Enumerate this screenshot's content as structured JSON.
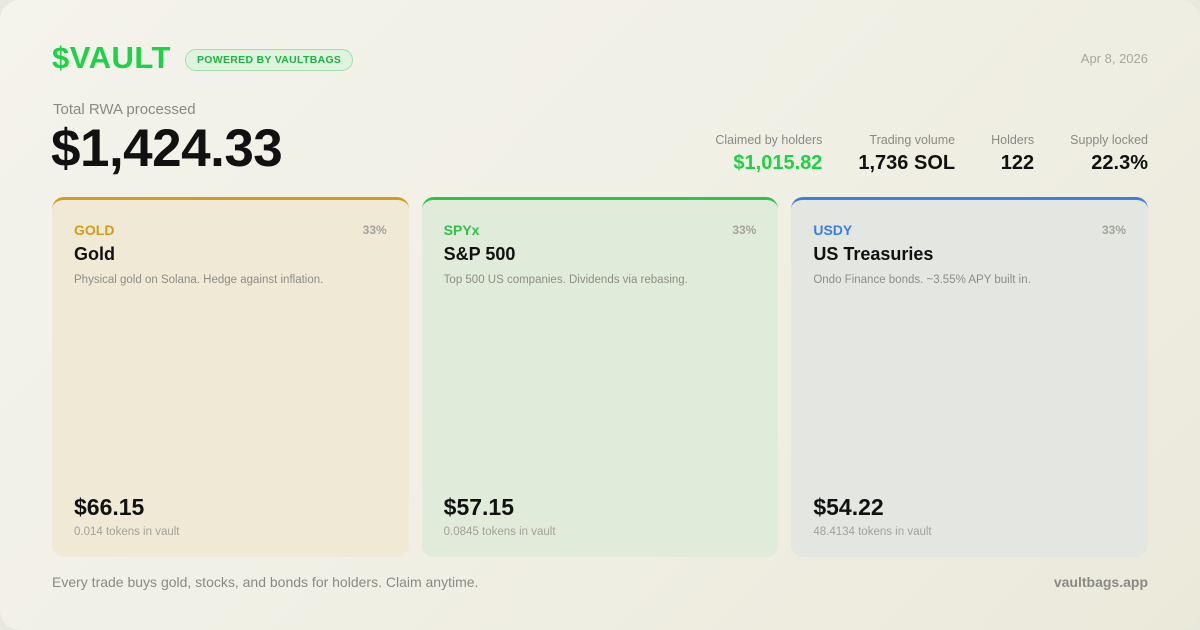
{
  "brand": {
    "name": "$VAULT",
    "badge": "POWERED BY VAULTBAGS"
  },
  "date": "Apr 8, 2026",
  "total": {
    "label": "Total RWA processed",
    "value": "$1,424.33"
  },
  "stats": [
    {
      "label": "Claimed by holders",
      "value": "$1,015.82"
    },
    {
      "label": "Trading volume",
      "value": "1,736 SOL"
    },
    {
      "label": "Holders",
      "value": "122"
    },
    {
      "label": "Supply locked",
      "value": "22.3%"
    }
  ],
  "assets": [
    {
      "ticker": "GOLD",
      "weight": "33%",
      "name": "Gold",
      "description": "Physical gold on Solana. Hedge against inflation.",
      "price": "$66.15",
      "tokens": "0.014 tokens in vault"
    },
    {
      "ticker": "SPYx",
      "weight": "33%",
      "name": "S&P 500",
      "description": "Top 500 US companies. Dividends via rebasing.",
      "price": "$57.15",
      "tokens": "0.0845 tokens in vault"
    },
    {
      "ticker": "USDY",
      "weight": "33%",
      "name": "US Treasuries",
      "description": "Ondo Finance bonds. ~3.55% APY built in.",
      "price": "$54.22",
      "tokens": "48.4134 tokens in vault"
    }
  ],
  "footer": {
    "tagline": "Every trade buys gold, stocks, and bonds for holders. Claim anytime.",
    "link": "vaultbags.app"
  },
  "colors": {
    "brand_green": "#1fd147",
    "gold": "#d49c1c",
    "spy": "#2ec24b",
    "usdy": "#3b7fe0"
  }
}
